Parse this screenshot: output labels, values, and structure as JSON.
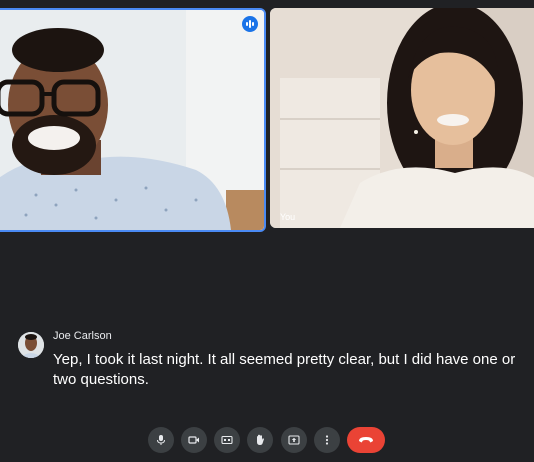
{
  "tiles": [
    {
      "id": "joe",
      "label": "",
      "speaking": true
    },
    {
      "id": "you",
      "label": "You"
    }
  ],
  "caption": {
    "speaker": "Joe Carlson",
    "text": "Yep, I took it last night. It all seemed pretty clear, but I did have one or two questions."
  },
  "controls": [
    {
      "name": "microphone",
      "icon": "mic-icon"
    },
    {
      "name": "camera",
      "icon": "videocam-icon"
    },
    {
      "name": "captions",
      "icon": "closed-caption-icon"
    },
    {
      "name": "raise-hand",
      "icon": "hand-icon"
    },
    {
      "name": "present",
      "icon": "present-screen-icon"
    },
    {
      "name": "more-options",
      "icon": "more-vert-icon"
    },
    {
      "name": "leave-call",
      "icon": "call-end-icon"
    }
  ],
  "colors": {
    "background": "#202124",
    "control": "#3c4043",
    "hangup": "#ea4335",
    "active_speaker_border": "#4a8af4"
  }
}
